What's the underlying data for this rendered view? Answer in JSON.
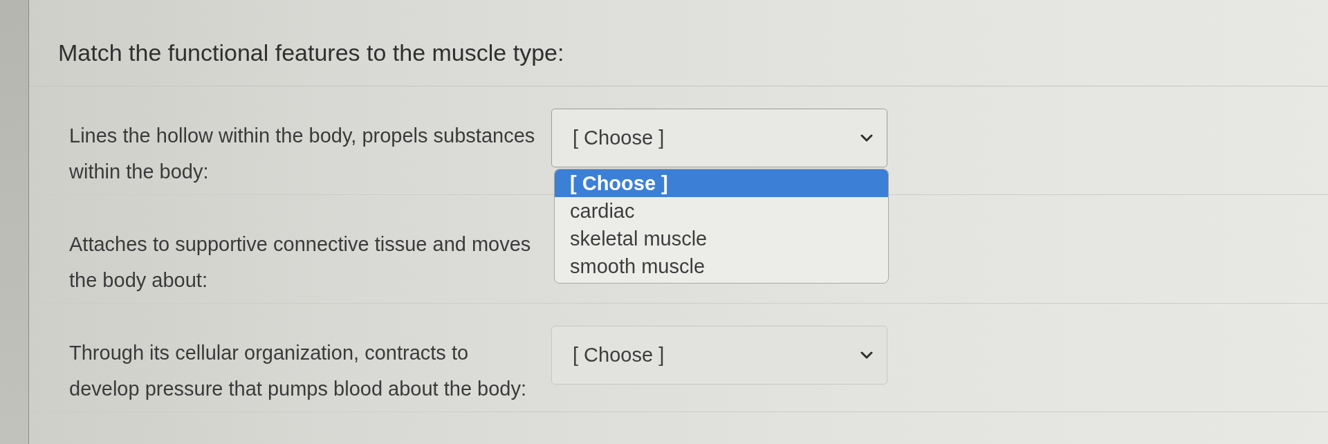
{
  "question": {
    "title": "Match the functional features to the muscle type:"
  },
  "rows": [
    {
      "prompt": "Lines the hollow within the body, propels substances within the body:",
      "select": {
        "value": "[ Choose ]",
        "expanded": true,
        "options": [
          {
            "label": "[ Choose ]",
            "selected": true
          },
          {
            "label": "cardiac",
            "selected": false
          },
          {
            "label": "skeletal muscle",
            "selected": false
          },
          {
            "label": "smooth muscle",
            "selected": false
          }
        ]
      }
    },
    {
      "prompt": "Attaches to supportive connective tissue and moves the body about:"
    },
    {
      "prompt": "Through its cellular organization, contracts to develop pressure that pumps blood about the body:",
      "select": {
        "value": "[ Choose ]",
        "expanded": false
      }
    }
  ]
}
